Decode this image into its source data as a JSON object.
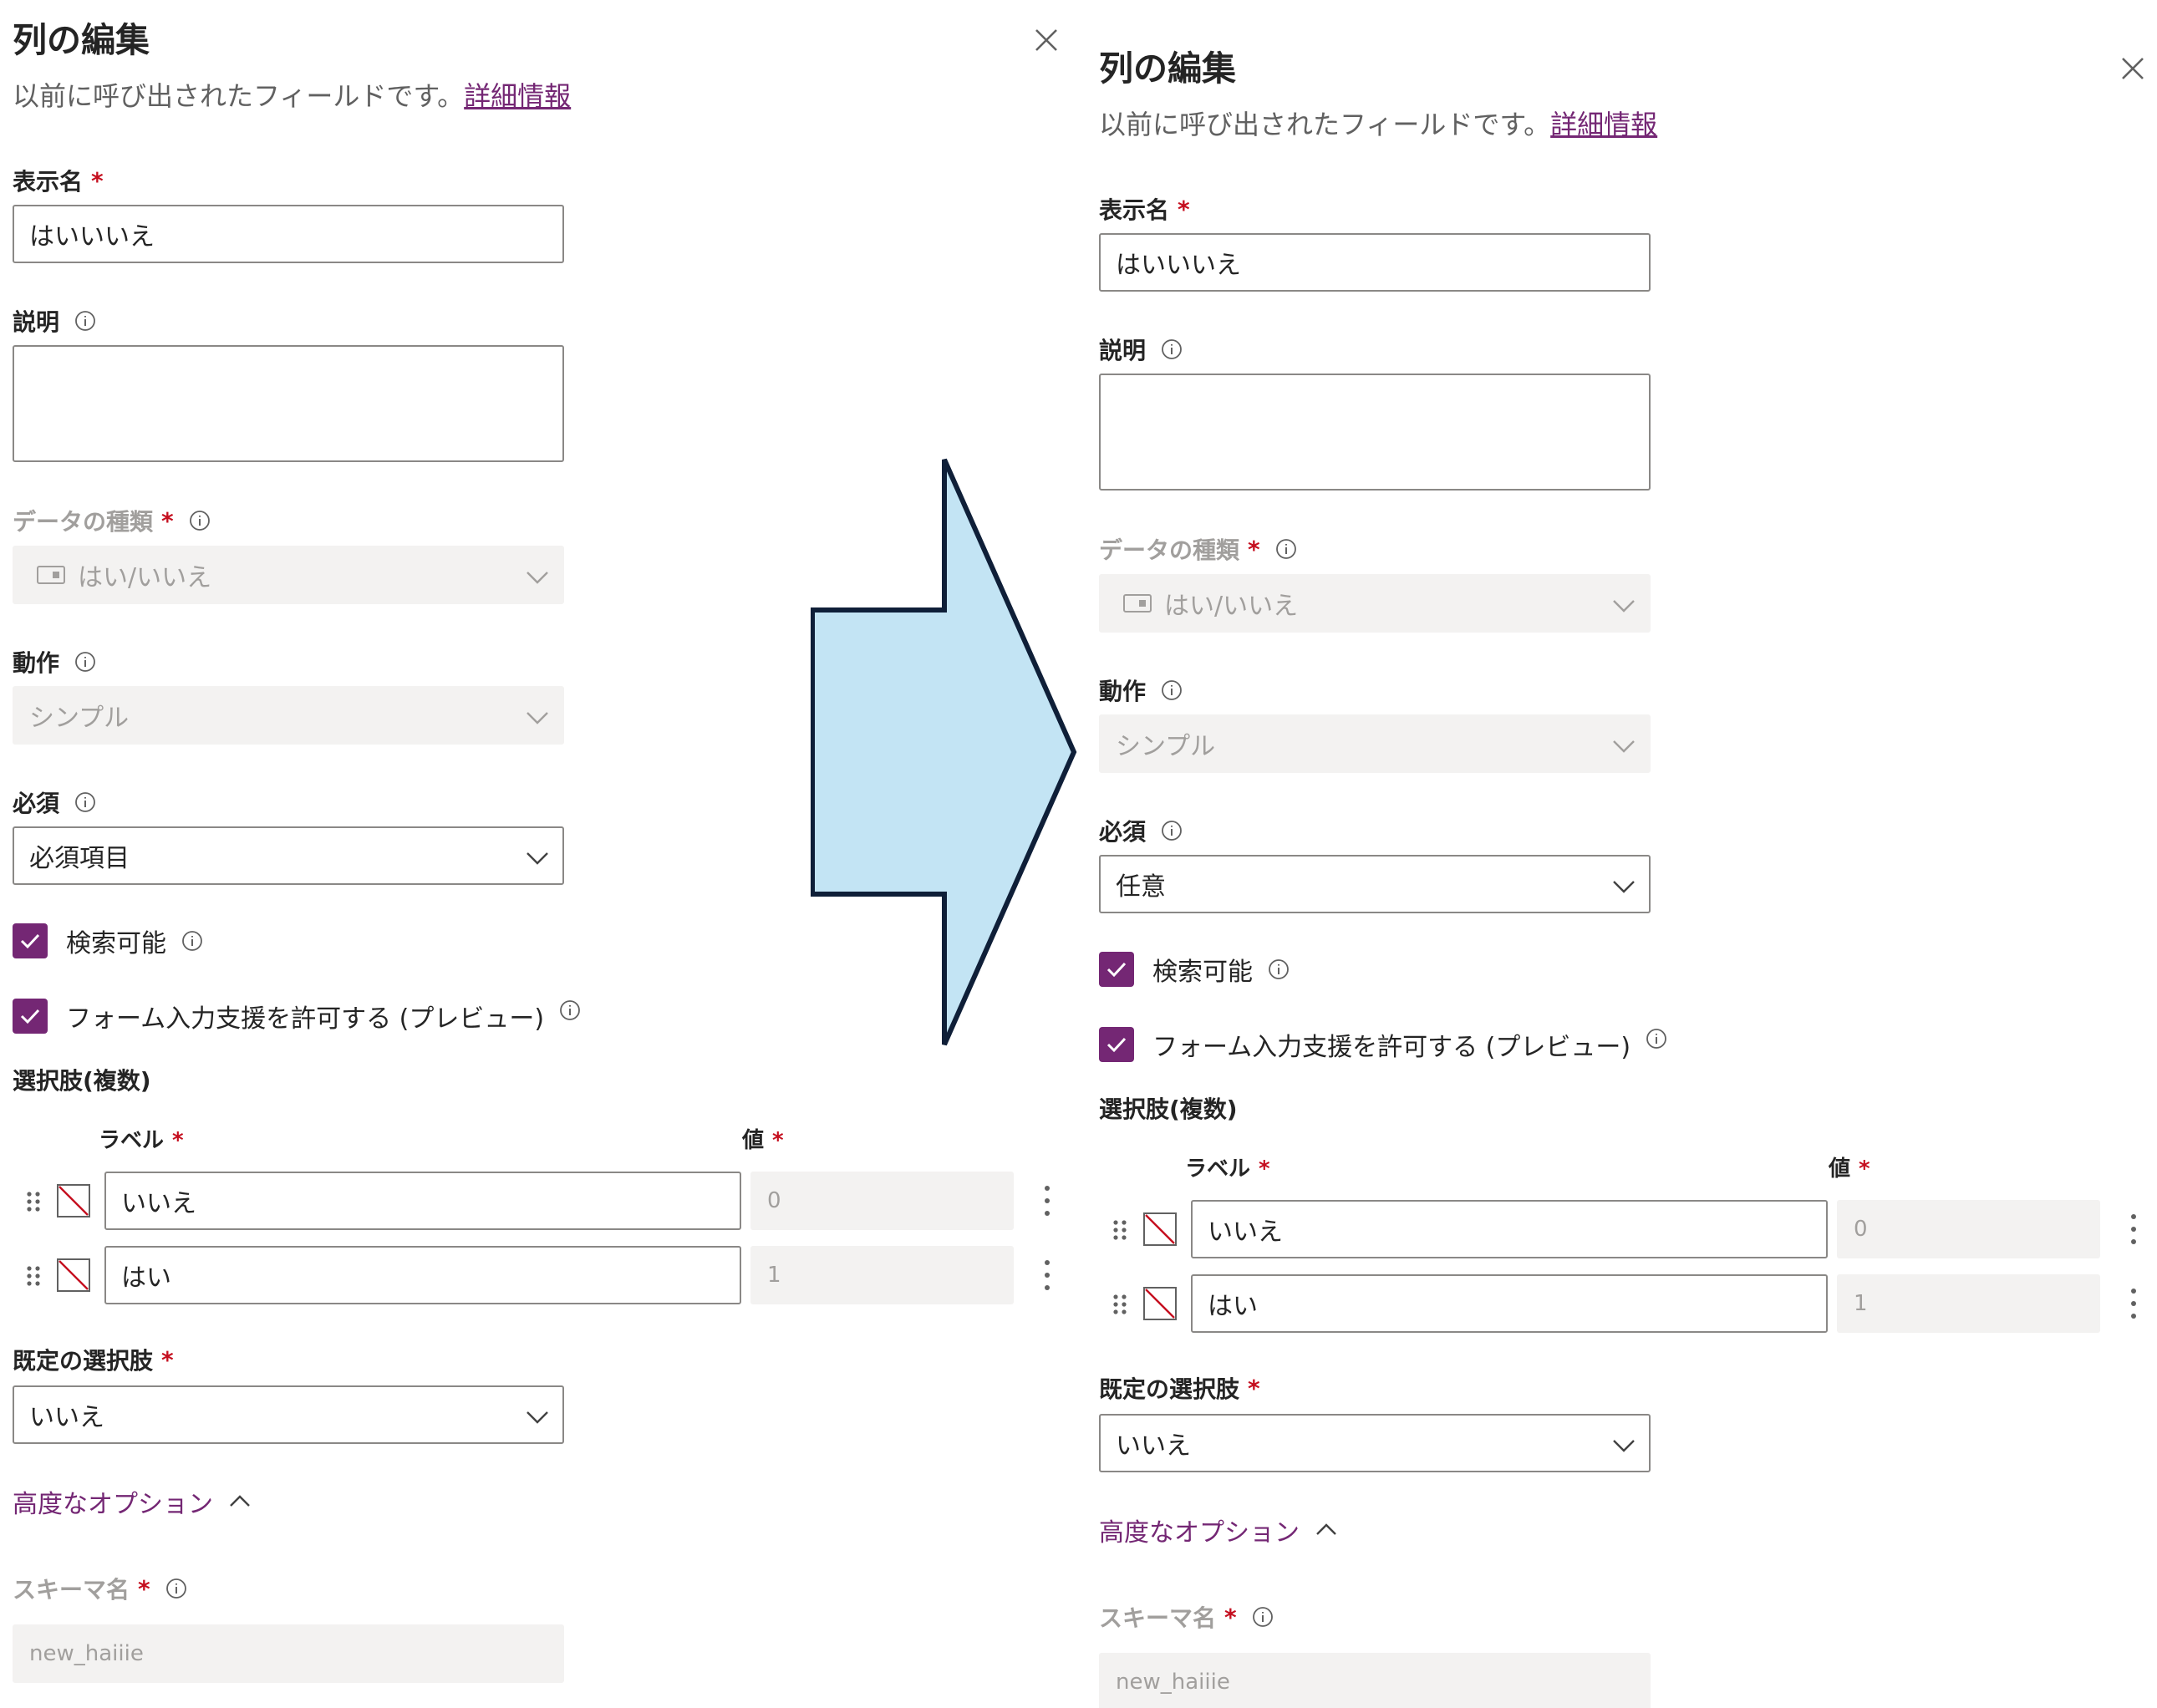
{
  "panels": [
    {
      "title": "列の編集",
      "subtitle": "以前に呼び出されたフィールドです。",
      "learn_more": "詳細情報",
      "display_name_label": "表示名",
      "display_name_value": "はいいいえ",
      "description_label": "説明",
      "description_value": "",
      "data_type_label": "データの種類",
      "data_type_value": "はい/いいえ",
      "behavior_label": "動作",
      "behavior_value": "シンプル",
      "required_label": "必須",
      "required_value": "必須項目",
      "searchable_label": "検索可能",
      "form_assist_label": "フォーム入力支援を許可する (プレビュー)",
      "choices_label": "選択肢(複数)",
      "choice_label_header": "ラベル",
      "choice_value_header": "値",
      "choices": [
        {
          "label": "いいえ",
          "value": "0"
        },
        {
          "label": "はい",
          "value": "1"
        }
      ],
      "default_choice_label": "既定の選択肢",
      "default_choice_value": "いいえ",
      "advanced_options": "高度なオプション",
      "schema_name_label": "スキーマ名",
      "schema_name_value": "new_haiiie"
    },
    {
      "title": "列の編集",
      "subtitle": "以前に呼び出されたフィールドです。",
      "learn_more": "詳細情報",
      "display_name_label": "表示名",
      "display_name_value": "はいいいえ",
      "description_label": "説明",
      "description_value": "",
      "data_type_label": "データの種類",
      "data_type_value": "はい/いいえ",
      "behavior_label": "動作",
      "behavior_value": "シンプル",
      "required_label": "必須",
      "required_value": "任意",
      "searchable_label": "検索可能",
      "form_assist_label": "フォーム入力支援を許可する (プレビュー)",
      "choices_label": "選択肢(複数)",
      "choice_label_header": "ラベル",
      "choice_value_header": "値",
      "choices": [
        {
          "label": "いいえ",
          "value": "0"
        },
        {
          "label": "はい",
          "value": "1"
        }
      ],
      "default_choice_label": "既定の選択肢",
      "default_choice_value": "いいえ",
      "advanced_options": "高度なオプション",
      "schema_name_label": "スキーマ名",
      "schema_name_value": "new_haiiie"
    }
  ],
  "required_marker": "*",
  "icons": {
    "close": "close-icon",
    "info": "info-icon",
    "chevron": "chevron-down-icon",
    "checkbox": "checkmark-icon",
    "boolean_type": "toggle-type-icon",
    "drag": "drag-handle-icon",
    "no_color": "no-color-icon",
    "more": "more-vertical-icon",
    "collapse": "chevron-up-icon",
    "transition_arrow": "right-arrow-icon"
  },
  "colors": {
    "accent": "#742774",
    "required": "#c50f1f",
    "disabled_bg": "#f3f2f1",
    "arrow_fill": "#c3e4f4",
    "arrow_stroke": "#0f1f38"
  }
}
